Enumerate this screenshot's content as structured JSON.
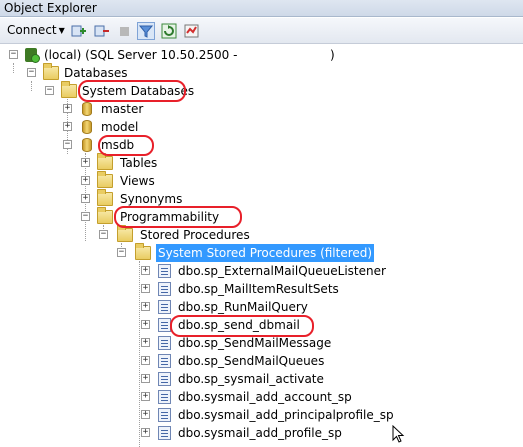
{
  "window": {
    "title": "Object Explorer"
  },
  "toolbar": {
    "connect_label": "Connect"
  },
  "tree": {
    "server": "(local) (SQL Server 10.50.2500 -",
    "server_suffix": ")",
    "databases": "Databases",
    "system_databases": "System Databases",
    "master": "master",
    "model": "model",
    "msdb": "msdb",
    "tables": "Tables",
    "views": "Views",
    "synonyms": "Synonyms",
    "programmability": "Programmability",
    "stored_procedures": "Stored Procedures",
    "system_stored_procedures": "System Stored Procedures (filtered)",
    "procs": [
      "dbo.sp_ExternalMailQueueListener",
      "dbo.sp_MailItemResultSets",
      "dbo.sp_RunMailQuery",
      "dbo.sp_send_dbmail",
      "dbo.sp_SendMailMessage",
      "dbo.sp_SendMailQueues",
      "dbo.sp_sysmail_activate",
      "dbo.sysmail_add_account_sp",
      "dbo.sysmail_add_principalprofile_sp",
      "dbo.sysmail_add_profile_sp"
    ]
  },
  "colors": {
    "highlight_ring": "#e8202a",
    "selection": "#3399ff"
  }
}
